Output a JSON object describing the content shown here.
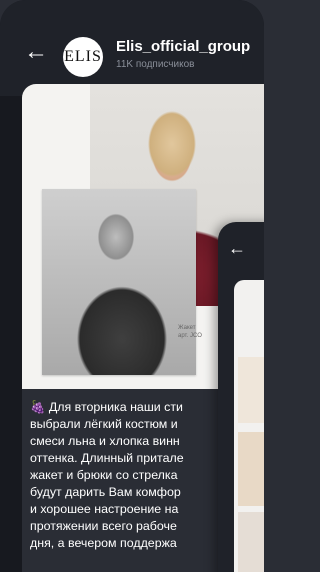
{
  "header": {
    "title": "Elis_official_group",
    "subtitle": "11K подписчиков",
    "avatar_text": "ELIS"
  },
  "post": {
    "image_caption_lines": [
      "Жакет",
      "арт. JCO"
    ],
    "text_lines": [
      "Для вторника наши сти",
      "выбрали лёгкий костюм и",
      "смеси льна и хлопка винн",
      "оттенка. Длинный притале",
      "жакет и брюки со стрелка",
      "будут дарить Вам комфор",
      "и хорошее настроение на",
      "протяжении всего рабоче",
      "дня, а вечером поддержа"
    ]
  },
  "icons": {
    "back": "arrow-left-icon",
    "emoji": "grapes-icon"
  },
  "colors": {
    "background": "#17191f",
    "header": "#1f2229",
    "text": "#ffffff",
    "muted": "#8a8f99"
  }
}
